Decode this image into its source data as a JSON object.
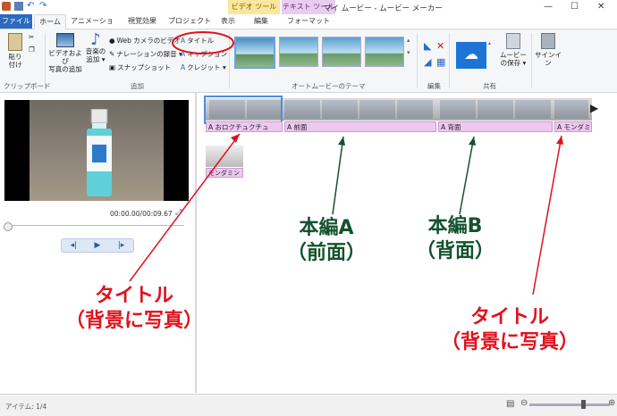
{
  "window": {
    "title": "マイ ムービー - ムービー メーカー",
    "context_tab_video": "ビデオ ツール",
    "context_tab_text": "テキスト ツール",
    "controls": {
      "minimize": "—",
      "maximize": "☐",
      "close": "✕"
    }
  },
  "tabs": [
    {
      "label": "ファイル"
    },
    {
      "label": "ホーム"
    },
    {
      "label": "アニメーション"
    },
    {
      "label": "視覚効果"
    },
    {
      "label": "プロジェクト"
    },
    {
      "label": "表示"
    },
    {
      "label": "編集"
    },
    {
      "label": "フォーマット"
    }
  ],
  "ribbon": {
    "clipboard": {
      "paste": "貼り",
      "paste2": "付け",
      "group": "クリップボード"
    },
    "add": {
      "add_video": "ビデオおよび",
      "add_video2": "写真の追加",
      "add_music": "音楽の",
      "add_music2": "追加 ▾",
      "webcam": "Web カメラのビデオ",
      "narration": "ナレーションの録音 ▾",
      "snapshot": "スナップショット",
      "title": "タイトル",
      "caption": "キャプション",
      "credit": "クレジット ▾",
      "group": "追加"
    },
    "themes": {
      "group": "オートムービーのテーマ"
    },
    "edit": {
      "group": "編集"
    },
    "share": {
      "save": "ムービー",
      "save2": "の保存 ▾",
      "group": "共有"
    },
    "signin": {
      "label": "サインイン"
    }
  },
  "preview": {
    "timecode": "00:00.00/00:09.67"
  },
  "storyboard": {
    "captions": [
      "おロクチュクチュ",
      "前面",
      "背面",
      "モンダミン"
    ],
    "standalone_caption": "モンダミン"
  },
  "annotations": {
    "title_left_1": "タイトル",
    "title_left_2": "（背景に写真）",
    "main_a_1": "本編A",
    "main_a_2": "（前面）",
    "main_b_1": "本編B",
    "main_b_2": "（背面）",
    "title_right_1": "タイトル",
    "title_right_2": "（背景に写真）"
  },
  "status": {
    "items": "アイテム: 1/4"
  },
  "colors": {
    "annotation_red": "#e0121d",
    "annotation_green": "#14522e",
    "file_tab": "#2b6bbf"
  }
}
